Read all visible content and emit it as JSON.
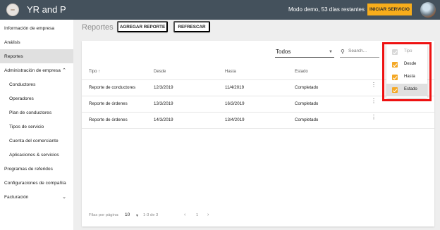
{
  "colors": {
    "topbar": "#44515c",
    "accent": "#f8ad1b",
    "checkbox": "#f4a825",
    "highlight": "#ee1111"
  },
  "header": {
    "app_title": "YR and P",
    "demo_text": "Modo demo, 53 días restantes",
    "start_button": "INICIAR SERVICIO",
    "logo_icon": "company-logo",
    "avatar_icon": "user-avatar"
  },
  "sidebar": {
    "items": [
      {
        "label": "Información de empresa"
      },
      {
        "label": "Análisis"
      },
      {
        "label": "Reportes",
        "active": true
      },
      {
        "label": "Administración de empresa",
        "chevron": "^"
      },
      {
        "label": "Conductores"
      },
      {
        "label": "Operadores"
      },
      {
        "label": "Plan de conductores"
      },
      {
        "label": "Tipos de servicio"
      },
      {
        "label": "Cuenta del comerciante"
      },
      {
        "label": "Aplicaciones & servicios"
      },
      {
        "label": "Programas de referidos"
      },
      {
        "label": "Configuraciones de compañía"
      },
      {
        "label": "Facturación",
        "chevron": "v"
      }
    ]
  },
  "toolbar": {
    "title": "Reportes",
    "add_button": "AGREGAR REPORTE",
    "refresh_button": "REFRESCAR"
  },
  "filters": {
    "status_value": "Todos",
    "search_placeholder": "Search..."
  },
  "table": {
    "headers": {
      "type": "Tipo ↑",
      "from": "Desde",
      "to": "Hasta",
      "status": "Estado"
    },
    "rows": [
      {
        "type": "Reporte de conductores",
        "from": "12/3/2019",
        "to": "11/4/2019",
        "status": "Completado"
      },
      {
        "type": "Reporte de órdenes",
        "from": "13/3/2019",
        "to": "16/3/2019",
        "status": "Completado"
      },
      {
        "type": "Reporte de órdenes",
        "from": "14/3/2019",
        "to": "13/4/2019",
        "status": "Completado"
      }
    ]
  },
  "pagination": {
    "rows_label": "Filas por página:",
    "rows_value": "10",
    "range": "1-3 de 3",
    "page": "1"
  },
  "column_menu": {
    "items": [
      {
        "label": "Tipo",
        "checked": true,
        "disabled": true
      },
      {
        "label": "Desde",
        "checked": true
      },
      {
        "label": "Hasta",
        "checked": true
      },
      {
        "label": "Estado",
        "checked": true,
        "active": true
      }
    ]
  }
}
